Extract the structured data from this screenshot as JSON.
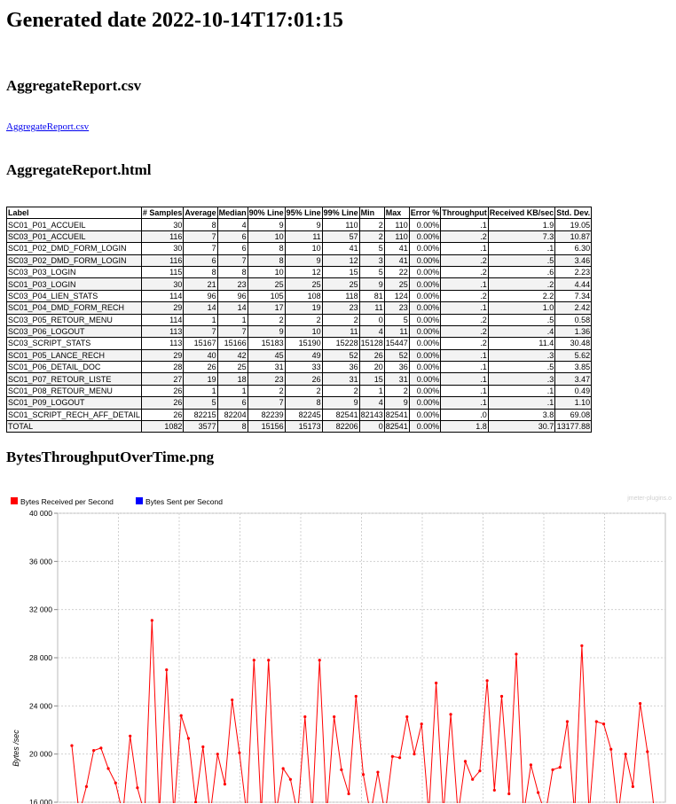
{
  "page": {
    "title": "Generated date 2022-10-14T17:01:15",
    "sections": {
      "csv_heading": "AggregateReport.csv",
      "csv_link": "AggregateReport.csv",
      "html_heading": "AggregateReport.html",
      "png_heading": "BytesThroughputOverTime.png"
    }
  },
  "report": {
    "headers": [
      "Label",
      "# Samples",
      "Average",
      "Median",
      "90% Line",
      "95% Line",
      "99% Line",
      "Min",
      "Max",
      "Error %",
      "Throughput",
      "Received KB/sec",
      "Std. Dev."
    ],
    "rows": [
      [
        "SC01_P01_ACCUEIL",
        "30",
        "8",
        "4",
        "9",
        "9",
        "110",
        "2",
        "110",
        "0.00%",
        ".1",
        "1.9",
        "19.05"
      ],
      [
        "SC03_P01_ACCUEIL",
        "116",
        "7",
        "6",
        "10",
        "11",
        "57",
        "2",
        "110",
        "0.00%",
        ".2",
        "7.3",
        "10.87"
      ],
      [
        "SC01_P02_DMD_FORM_LOGIN",
        "30",
        "7",
        "6",
        "8",
        "10",
        "41",
        "5",
        "41",
        "0.00%",
        ".1",
        ".1",
        "6.30"
      ],
      [
        "SC03_P02_DMD_FORM_LOGIN",
        "116",
        "6",
        "7",
        "8",
        "9",
        "12",
        "3",
        "41",
        "0.00%",
        ".2",
        ".5",
        "3.46"
      ],
      [
        "SC03_P03_LOGIN",
        "115",
        "8",
        "8",
        "10",
        "12",
        "15",
        "5",
        "22",
        "0.00%",
        ".2",
        ".6",
        "2.23"
      ],
      [
        "SC01_P03_LOGIN",
        "30",
        "21",
        "23",
        "25",
        "25",
        "25",
        "9",
        "25",
        "0.00%",
        ".1",
        ".2",
        "4.44"
      ],
      [
        "SC03_P04_LIEN_STATS",
        "114",
        "96",
        "96",
        "105",
        "108",
        "118",
        "81",
        "124",
        "0.00%",
        ".2",
        "2.2",
        "7.34"
      ],
      [
        "SC01_P04_DMD_FORM_RECH",
        "29",
        "14",
        "14",
        "17",
        "19",
        "23",
        "11",
        "23",
        "0.00%",
        ".1",
        "1.0",
        "2.42"
      ],
      [
        "SC03_P05_RETOUR_MENU",
        "114",
        "1",
        "1",
        "2",
        "2",
        "2",
        "0",
        "5",
        "0.00%",
        ".2",
        ".5",
        "0.58"
      ],
      [
        "SC03_P06_LOGOUT",
        "113",
        "7",
        "7",
        "9",
        "10",
        "11",
        "4",
        "11",
        "0.00%",
        ".2",
        ".4",
        "1.36"
      ],
      [
        "SC03_SCRIPT_STATS",
        "113",
        "15167",
        "15166",
        "15183",
        "15190",
        "15228",
        "15128",
        "15447",
        "0.00%",
        ".2",
        "11.4",
        "30.48"
      ],
      [
        "SC01_P05_LANCE_RECH",
        "29",
        "40",
        "42",
        "45",
        "49",
        "52",
        "26",
        "52",
        "0.00%",
        ".1",
        ".3",
        "5.62"
      ],
      [
        "SC01_P06_DETAIL_DOC",
        "28",
        "26",
        "25",
        "31",
        "33",
        "36",
        "20",
        "36",
        "0.00%",
        ".1",
        ".5",
        "3.85"
      ],
      [
        "SC01_P07_RETOUR_LISTE",
        "27",
        "19",
        "18",
        "23",
        "26",
        "31",
        "15",
        "31",
        "0.00%",
        ".1",
        ".3",
        "3.47"
      ],
      [
        "SC01_P08_RETOUR_MENU",
        "26",
        "1",
        "1",
        "2",
        "2",
        "2",
        "1",
        "2",
        "0.00%",
        ".1",
        ".1",
        "0.49"
      ],
      [
        "SC01_P09_LOGOUT",
        "26",
        "5",
        "6",
        "7",
        "8",
        "9",
        "4",
        "9",
        "0.00%",
        ".1",
        ".1",
        "1.10"
      ],
      [
        "SC01_SCRIPT_RECH_AFF_DETAIL",
        "26",
        "82215",
        "82204",
        "82239",
        "82245",
        "82541",
        "82143",
        "82541",
        "0.00%",
        ".0",
        "3.8",
        "69.08"
      ]
    ],
    "total": [
      "TOTAL",
      "1082",
      "3577",
      "8",
      "15156",
      "15173",
      "82206",
      "0",
      "82541",
      "0.00%",
      "1.8",
      "30.7",
      "13177.88"
    ]
  },
  "chart_data": {
    "type": "line",
    "title": "",
    "watermark": "jmeter-plugins.o",
    "ylabel": "Bytes /sec",
    "ylim": [
      16000,
      40000
    ],
    "yticks": [
      "16 000",
      "20 000",
      "24 000",
      "28 000",
      "32 000",
      "36 000",
      "40 000"
    ],
    "grid": true,
    "legend_position": "top-left",
    "series": [
      {
        "name": "Bytes Received per Second",
        "color": "#ff0000",
        "values": [
          20700,
          15000,
          17300,
          20300,
          20500,
          18800,
          17600,
          15000,
          21500,
          17200,
          15000,
          31100,
          15000,
          27000,
          15000,
          23200,
          21300,
          16000,
          20600,
          15000,
          20000,
          17500,
          24500,
          20100,
          15000,
          27800,
          15000,
          27800,
          15000,
          18800,
          17900,
          15000,
          23100,
          15000,
          27800,
          15000,
          23100,
          18700,
          16700,
          24800,
          18300,
          15000,
          18500,
          15000,
          19800,
          19700,
          23100,
          20000,
          22500,
          15000,
          25900,
          15000,
          23300,
          15000,
          19400,
          17900,
          18600,
          26100,
          17000,
          24800,
          16700,
          28300,
          15000,
          19100,
          16800,
          15000,
          18700,
          18900,
          22700,
          15000,
          29000,
          15000,
          22700,
          22500,
          20400,
          15000,
          20000,
          17300,
          24200,
          20200,
          15000
        ]
      },
      {
        "name": "Bytes Sent per Second",
        "color": "#0000ff",
        "values": []
      }
    ]
  }
}
